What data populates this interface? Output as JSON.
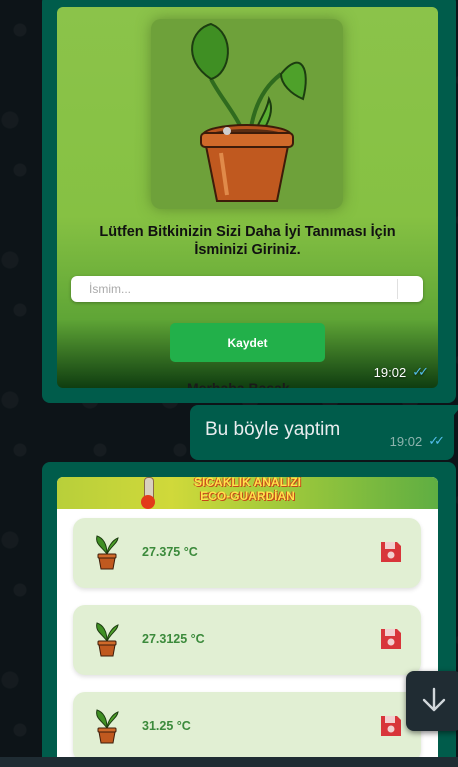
{
  "messages": {
    "first": {
      "screenshot": {
        "title": "Lütfen Bitkinizin Sizi Daha İyi Tanıması İçin İsminizi Giriniz.",
        "input_placeholder": "İsmim...",
        "save_label": "Kaydet",
        "cut_text": "Merhaba Başak"
      },
      "time": "19:02",
      "status_icon": "double-check-read"
    },
    "second": {
      "text": "Bu böyle yaptim",
      "time": "19:02",
      "status_icon": "double-check-read"
    },
    "third": {
      "screenshot": {
        "banner_line1": "SICAKLIK ANALİZİ",
        "banner_line2": "ECO-GUARDİAN",
        "readings": [
          "27.375 °C",
          "27.3125 °C",
          "31.25 °C"
        ]
      }
    }
  },
  "colors": {
    "bubble": "#005c4b",
    "read_ticks": "#53bdeb",
    "save_button": "#22b04a",
    "card_bg": "#e1efd3",
    "floppy_icon": "#d8353a"
  },
  "scroll_button_icon": "arrow-down-icon"
}
